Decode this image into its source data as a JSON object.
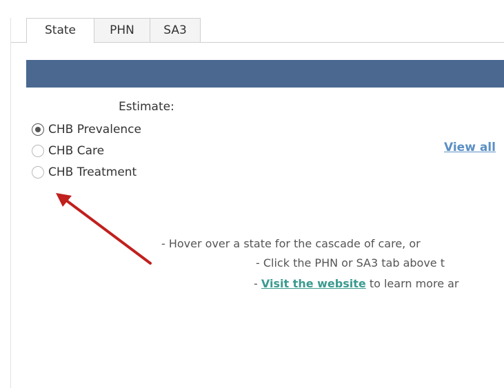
{
  "tabs": [
    {
      "label": "State",
      "active": true
    },
    {
      "label": "PHN",
      "active": false
    },
    {
      "label": "SA3",
      "active": false
    }
  ],
  "header_bar_color": "#4a6890",
  "estimate": {
    "label": "Estimate:",
    "options": [
      {
        "label": "CHB Prevalence",
        "checked": true
      },
      {
        "label": "CHB Care",
        "checked": false
      },
      {
        "label": "CHB Treatment",
        "checked": false
      }
    ]
  },
  "view_all_link": "View all",
  "info": {
    "line1": "- Hover over a state for the cascade of care, or",
    "line2": "- Click the PHN or SA3 tab above t",
    "line3_prefix": "- ",
    "line3_link": "Visit the website",
    "line3_suffix": " to learn more ar"
  },
  "annotation_arrow_color": "#c0201e"
}
